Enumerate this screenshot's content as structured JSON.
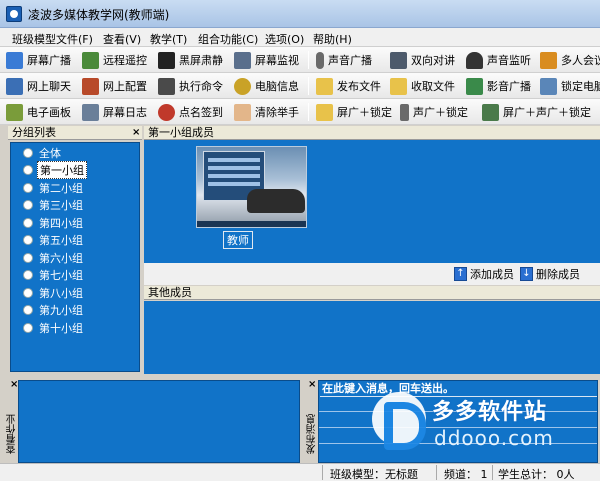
{
  "window": {
    "title": "凌波多媒体教学网(教师端)"
  },
  "menubar": [
    {
      "label": "班级模型文件(F)"
    },
    {
      "label": "查看(V)"
    },
    {
      "label": "教学(T)"
    },
    {
      "label": "组合功能(C)"
    },
    {
      "label": "选项(O)"
    },
    {
      "label": "帮助(H)"
    }
  ],
  "toolbar_row1": [
    {
      "label": "屏幕广播",
      "icon": "screen-broadcast-icon"
    },
    {
      "label": "远程遥控",
      "icon": "remote-control-icon"
    },
    {
      "label": "黑屏肃静",
      "icon": "black-screen-icon"
    },
    {
      "label": "屏幕监视",
      "icon": "screen-monitor-icon"
    },
    {
      "label": "声音广播",
      "icon": "microphone-icon"
    },
    {
      "label": "双向对讲",
      "icon": "intercom-icon"
    },
    {
      "label": "声音监听",
      "icon": "headphones-icon"
    },
    {
      "label": "多人会议",
      "icon": "conference-icon"
    }
  ],
  "toolbar_row2": [
    {
      "label": "网上聊天",
      "icon": "chat-icon"
    },
    {
      "label": "网上配置",
      "icon": "network-config-icon"
    },
    {
      "label": "执行命令",
      "icon": "command-icon"
    },
    {
      "label": "电脑信息",
      "icon": "computer-info-icon"
    },
    {
      "label": "发布文件",
      "icon": "send-file-icon"
    },
    {
      "label": "收取文件",
      "icon": "receive-file-icon"
    },
    {
      "label": "影音广播",
      "icon": "video-broadcast-icon"
    },
    {
      "label": "锁定电脑",
      "icon": "lock-computer-icon"
    }
  ],
  "toolbar_row3": [
    {
      "label": "电子画板",
      "icon": "whiteboard-icon"
    },
    {
      "label": "屏幕日志",
      "icon": "screen-log-icon"
    },
    {
      "label": "点名签到",
      "icon": "roll-call-icon"
    },
    {
      "label": "清除举手",
      "icon": "clear-hand-icon"
    },
    {
      "label": "屏广＋锁定",
      "icon": "screen-lock-icon"
    },
    {
      "label": "声广＋锁定",
      "icon": "sound-lock-icon"
    },
    {
      "label": "屏广＋声广＋锁定",
      "icon": "screen-sound-lock-icon"
    }
  ],
  "group_panel": {
    "title": "分组列表",
    "items": [
      {
        "label": "全体"
      },
      {
        "label": "第一小组"
      },
      {
        "label": "第二小组"
      },
      {
        "label": "第三小组"
      },
      {
        "label": "第四小组"
      },
      {
        "label": "第五小组"
      },
      {
        "label": "第六小组"
      },
      {
        "label": "第七小组"
      },
      {
        "label": "第八小组"
      },
      {
        "label": "第九小组"
      },
      {
        "label": "第十小组"
      }
    ],
    "selected": "第一小组"
  },
  "members_panel": {
    "title": "第一小组成员",
    "teacher_label": "教师",
    "add_label": "添加成员",
    "remove_label": "删除成员"
  },
  "others_panel": {
    "title": "其他成员"
  },
  "bottom_left": {
    "vertical_label": "查看作业"
  },
  "message_panel": {
    "vertical_label": "发布消息",
    "input_placeholder": "在此键入消息，回车送出。"
  },
  "statusbar": {
    "model": "班级模型：无标题",
    "channel": "频道： 1",
    "students": "学生总计：  0人"
  },
  "watermark": {
    "title": "多多软件站",
    "domain": "ddooo.com"
  },
  "colors": {
    "panel_blue": "#1173c8",
    "title_blue": "#a9c4e6"
  }
}
